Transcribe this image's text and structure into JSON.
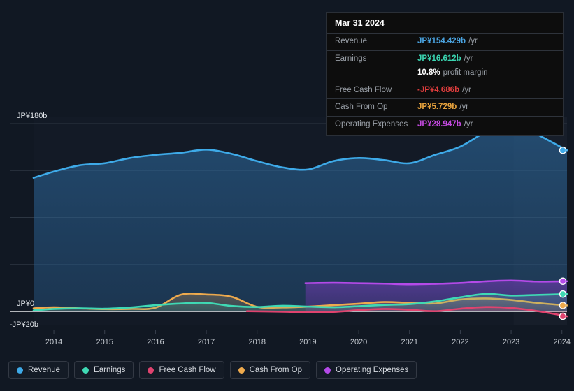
{
  "tooltip": {
    "date": "Mar 31 2024",
    "rows": [
      {
        "label": "Revenue",
        "value": "JP¥154.429b",
        "unit": "/yr",
        "color": "#4aa3e0"
      },
      {
        "label": "Earnings",
        "value": "JP¥16.612b",
        "unit": "/yr",
        "color": "#3ad4b0"
      },
      {
        "label": "Free Cash Flow",
        "value": "-JP¥4.686b",
        "unit": "/yr",
        "color": "#e03d3d"
      },
      {
        "label": "Cash From Op",
        "value": "JP¥5.729b",
        "unit": "/yr",
        "color": "#e8a33d"
      },
      {
        "label": "Operating Expenses",
        "value": "JP¥28.947b",
        "unit": "/yr",
        "color": "#c44ae0"
      }
    ],
    "profit_margin_value": "10.8%",
    "profit_margin_label": "profit margin"
  },
  "legend": [
    {
      "label": "Revenue",
      "color": "#3eaae8"
    },
    {
      "label": "Earnings",
      "color": "#3fd9b4"
    },
    {
      "label": "Free Cash Flow",
      "color": "#e0436f"
    },
    {
      "label": "Cash From Op",
      "color": "#eeaa4d"
    },
    {
      "label": "Operating Expenses",
      "color": "#b44ae8"
    }
  ],
  "chart_data": {
    "type": "area",
    "title": "",
    "xlabel": "",
    "ylabel": "",
    "currency": "JP¥",
    "units": "billions",
    "ylim": [
      -20,
      200
    ],
    "grid": true,
    "legend_position": "bottom",
    "y_axis_labels": [
      "JP¥180b",
      "JP¥0",
      "-JP¥20b"
    ],
    "y_gridline_values": [
      180,
      135,
      90,
      45,
      0
    ],
    "x_tick_labels": [
      "2014",
      "2015",
      "2016",
      "2017",
      "2018",
      "2019",
      "2020",
      "2021",
      "2022",
      "2023",
      "2024"
    ],
    "x": [
      2013.6,
      2014,
      2014.5,
      2015,
      2015.5,
      2016,
      2016.5,
      2017,
      2017.5,
      2018,
      2018.5,
      2019,
      2019.5,
      2020,
      2020.5,
      2021,
      2021.5,
      2022,
      2022.5,
      2023,
      2023.5,
      2024.1
    ],
    "series": [
      {
        "name": "Revenue",
        "color": "#3eaae8",
        "fill": "rgba(46,108,160,0.45)",
        "values": [
          128,
          134,
          140,
          142,
          147,
          150,
          152,
          155,
          151,
          144,
          138,
          136,
          144,
          147,
          145,
          142,
          150,
          158,
          172,
          182,
          170,
          154.429
        ],
        "last_value": 154.429
      },
      {
        "name": "Earnings",
        "color": "#3fd9b4",
        "fill": "rgba(63,217,180,0.18)",
        "values": [
          1.0,
          2.4,
          3.0,
          2.6,
          3.8,
          6.0,
          7.6,
          8.2,
          5.2,
          4.2,
          5.4,
          4.6,
          4.0,
          5.0,
          6.2,
          7.0,
          9.6,
          13.5,
          16.8,
          15.2,
          15.8,
          16.612
        ],
        "last_value": 16.612
      },
      {
        "name": "Free Cash Flow",
        "color": "#e0436f",
        "fill": "rgba(224,67,111,0.18)",
        "start_x": 2017.8,
        "values": [
          null,
          null,
          null,
          null,
          null,
          null,
          null,
          null,
          null,
          0.2,
          -0.3,
          -0.8,
          -0.5,
          1.2,
          2.4,
          1.6,
          0.2,
          2.6,
          4.2,
          3.4,
          0.4,
          -4.686
        ],
        "last_value": -4.686
      },
      {
        "name": "Cash From Op",
        "color": "#eeaa4d",
        "fill": "rgba(238,170,77,0.20)",
        "values": [
          3.0,
          4.0,
          3.0,
          2.2,
          2.4,
          3.6,
          16.0,
          16.2,
          14.0,
          4.4,
          3.8,
          4.6,
          6.0,
          7.4,
          9.0,
          8.2,
          7.6,
          11.4,
          12.4,
          11.0,
          8.2,
          5.729
        ],
        "last_value": 5.729
      },
      {
        "name": "Operating Expenses",
        "color": "#b44ae8",
        "fill": "rgba(124,62,190,0.42)",
        "start_x": 2018.95,
        "values": [
          null,
          null,
          null,
          null,
          null,
          null,
          null,
          null,
          null,
          null,
          null,
          27.0,
          27.4,
          27.0,
          26.6,
          26.0,
          26.4,
          27.2,
          28.8,
          29.6,
          28.6,
          28.947
        ],
        "last_value": 28.947
      }
    ],
    "forecast_region": {
      "from": "2023.05",
      "to": "2024.25",
      "shaded": true
    }
  }
}
